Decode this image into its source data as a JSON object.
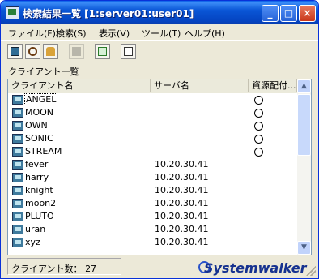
{
  "window": {
    "title": "検索結果一覧 [1:server01:user01]",
    "controls": [
      "_",
      "□",
      "×"
    ]
  },
  "menu": [
    {
      "label": "ファイル(F)"
    },
    {
      "label": "検索(S)"
    },
    {
      "label": "表示(V)"
    },
    {
      "label": "ツール(T)"
    },
    {
      "label": "ヘルプ(H)"
    }
  ],
  "toolbar": {
    "tools": [
      {
        "icon": "list-icon",
        "enabled": true
      },
      {
        "icon": "find-icon",
        "enabled": true
      },
      {
        "icon": "user-icon",
        "enabled": true
      },
      {
        "icon": "print-icon",
        "enabled": false
      },
      {
        "icon": "refresh-icon",
        "enabled": true
      },
      {
        "icon": "export-icon",
        "enabled": true
      }
    ]
  },
  "section_label": "クライアント一覧",
  "list": {
    "columns": [
      "クライアント名",
      "サーバ名",
      "資源配付..."
    ],
    "rows": [
      {
        "name": "ANGEL",
        "server": "",
        "assigned": true,
        "focused": true
      },
      {
        "name": "MOON",
        "server": "",
        "assigned": true
      },
      {
        "name": "OWN",
        "server": "",
        "assigned": true
      },
      {
        "name": "SONIC",
        "server": "",
        "assigned": true
      },
      {
        "name": "STREAM",
        "server": "",
        "assigned": true
      },
      {
        "name": "fever",
        "server": "10.20.30.41",
        "assigned": false
      },
      {
        "name": "harry",
        "server": "10.20.30.41",
        "assigned": false
      },
      {
        "name": "knight",
        "server": "10.20.30.41",
        "assigned": false
      },
      {
        "name": "moon2",
        "server": "10.20.30.41",
        "assigned": false
      },
      {
        "name": "PLUTO",
        "server": "10.20.30.41",
        "assigned": false
      },
      {
        "name": "uran",
        "server": "10.20.30.41",
        "assigned": false
      },
      {
        "name": "xyz",
        "server": "10.20.30.41",
        "assigned": false
      }
    ],
    "scroll_up": "▲",
    "scroll_down": "▼"
  },
  "status": {
    "client_count_label": "クライアント数：",
    "client_count": "27",
    "brand": "Systemwalker"
  },
  "colors": {
    "title_bar": "#0a56d6",
    "list_border": "#7f9db9",
    "brand": "#16328f"
  }
}
